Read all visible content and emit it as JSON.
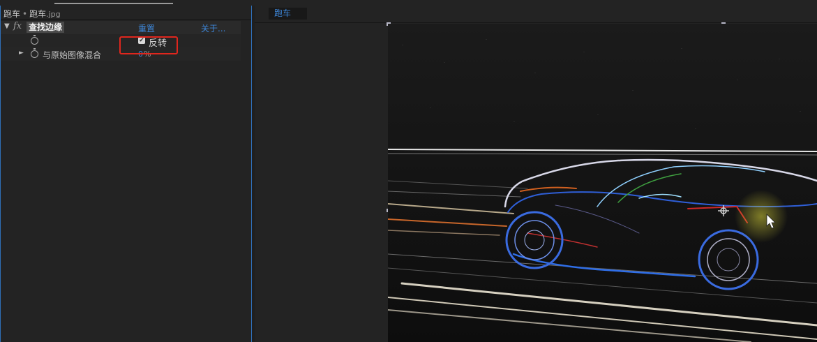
{
  "effect_controls": {
    "layer_name": "跑车",
    "source_name": "跑车",
    "source_ext": ".jpg",
    "effect_name": "查找边缘",
    "fx_label": "fx",
    "reset_label": "重置",
    "about_label": "关于...",
    "invert": {
      "label": "反转",
      "checked": true
    },
    "blend": {
      "label": "与原始图像混合",
      "value": "0",
      "unit": "%"
    }
  },
  "composition": {
    "tab_label": "跑车"
  },
  "colors": {
    "accent_blue": "#3d86d8",
    "highlight_red": "#e0261d",
    "panel_bg": "#232323"
  },
  "icons": [
    "twirl-down-icon",
    "fx-icon",
    "stopwatch-icon",
    "checkbox-icon",
    "twirl-right-icon",
    "cursor-icon"
  ]
}
